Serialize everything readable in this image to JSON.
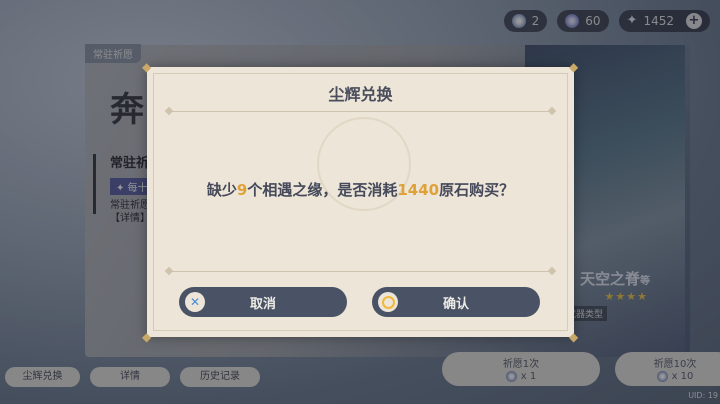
{
  "top_bar": {
    "fate_count": "2",
    "gem_count": "60",
    "primogem_count": "1452",
    "plus_label": "+"
  },
  "banner": {
    "tag": "常驻祈愿",
    "title": "奔",
    "subtitle": "常驻祈",
    "chip": "✦ 每十",
    "line1": "常驻祈愿",
    "line2": "【详情】"
  },
  "weapon": {
    "name": "天空之脊",
    "suffix": "等",
    "stars": "★★★★",
    "type": "武器类型"
  },
  "bottom": {
    "stardust_exchange": "尘辉兑换",
    "details": "详情",
    "history": "历史记录",
    "wish1_label": "祈愿1次",
    "wish1_cost": "x 1",
    "wish10_label": "祈愿10次",
    "wish10_cost": "x 10",
    "uid": "UID: 19"
  },
  "dialog": {
    "title": "尘辉兑换",
    "msg_part1": "缺少",
    "msg_num1": "9",
    "msg_part2": "个相遇之缘，是否消耗",
    "msg_num2": "1440",
    "msg_part3": "原石购买？",
    "cancel_label": "取消",
    "confirm_label": "确认"
  },
  "icons": {
    "cancel": "x-icon",
    "confirm": "circle-icon",
    "fate": "fate-icon",
    "gem": "gem-icon",
    "primogem": "primogem-icon"
  },
  "colors": {
    "accent_gold": "#e0a238",
    "dialog_bg": "#ece5d8",
    "button_bg": "#4a5366"
  }
}
